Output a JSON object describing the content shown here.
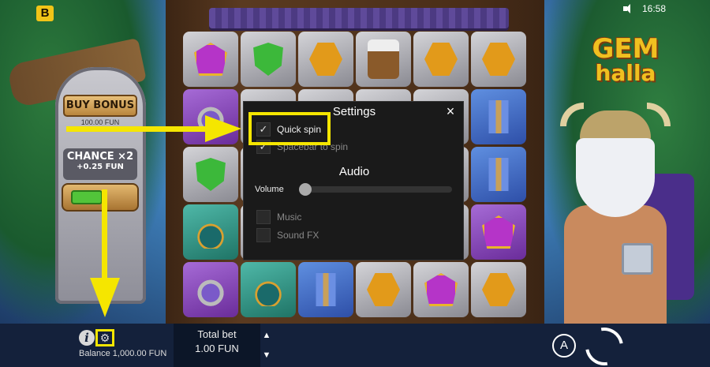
{
  "brand_badge": "B",
  "status": {
    "time": "16:58"
  },
  "left_panel": {
    "buy_bonus_label": "BUY BONUS",
    "buy_bonus_price": "100.00 FUN",
    "chance_title": "CHANCE ×2",
    "chance_price": "+0.25 FUN"
  },
  "logo": {
    "line1": "GEM",
    "line2": "halla"
  },
  "grid": [
    [
      "purple",
      "green",
      "gold",
      "mug",
      "gold",
      "gold"
    ],
    [
      "helmet",
      "",
      "",
      "",
      "",
      "axe"
    ],
    [
      "green",
      "",
      "",
      "",
      "",
      "axe"
    ],
    [
      "pouch",
      "",
      "",
      "",
      "",
      "purple"
    ],
    [
      "helmet",
      "pouch",
      "axe",
      "gold",
      "purple",
      "gold"
    ]
  ],
  "grid_cell_colors": [
    [
      "stone",
      "stone",
      "stone",
      "stone",
      "stone",
      "stone"
    ],
    [
      "purple",
      "stone",
      "stone",
      "stone",
      "stone",
      "blue"
    ],
    [
      "stone",
      "stone",
      "stone",
      "stone",
      "stone",
      "blue"
    ],
    [
      "teal",
      "stone",
      "stone",
      "stone",
      "stone",
      "purple"
    ],
    [
      "purple",
      "teal",
      "blue",
      "stone",
      "stone",
      "stone"
    ]
  ],
  "settings": {
    "title": "Settings",
    "quick_spin": {
      "label": "Quick spin",
      "checked": true
    },
    "spacebar": {
      "label": "Spacebar to spin",
      "checked": true
    },
    "audio_heading": "Audio",
    "volume_label": "Volume",
    "volume_value": 0,
    "music": {
      "label": "Music",
      "checked": false
    },
    "sound_fx": {
      "label": "Sound FX",
      "checked": false
    }
  },
  "bottom_bar": {
    "balance": "Balance 1,000.00 FUN",
    "total_bet_label": "Total bet",
    "total_bet_value": "1.00 FUN",
    "autoplay_label": "A"
  },
  "colors": {
    "highlight": "#f5e600",
    "modal_bg": "#1a1a1a",
    "bar_bg": "#14213b"
  }
}
